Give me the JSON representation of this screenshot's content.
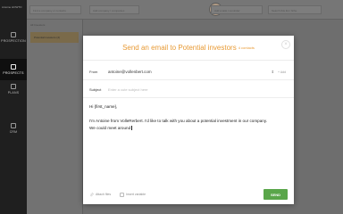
{
  "app": {
    "rail_header": "Antoine HOWTO",
    "rail_items": [
      {
        "label": "PROSPECTION",
        "icon": "search-icon"
      },
      {
        "label": "PROSPECTS",
        "icon": "users-icon"
      },
      {
        "label": "PLANS",
        "icon": "calendar-icon"
      },
      {
        "label": "CRM",
        "icon": "list-icon"
      }
    ],
    "topbar_fields": [
      "Find a company or contacts",
      "Add company / companies",
      "Add a task / reminder",
      "Search this list / fiche"
    ],
    "list_header": "All Investors",
    "list_items": [
      "Potential investors (4)"
    ]
  },
  "modal": {
    "title": "Send an email to Potential investors",
    "count": "4 contacts",
    "close_symbol": "×",
    "from_label": "From",
    "from_value": "antoine@vollenbert.com",
    "add_label": "+ Add",
    "subject_label": "Subject",
    "subject_placeholder": "Enter a cute subject here",
    "body_lines": [
      "Hi {first_name},",
      "",
      "I'm Antoine from VolleRerbert. I'd like to talk with you about a potential investment in our company.",
      "We could meet around"
    ],
    "attach_label": "Attach files",
    "insert_variable_label": "Insert variable",
    "send_label": "SEND"
  },
  "colors": {
    "accent": "#e89a34",
    "send": "#5aa64a"
  }
}
